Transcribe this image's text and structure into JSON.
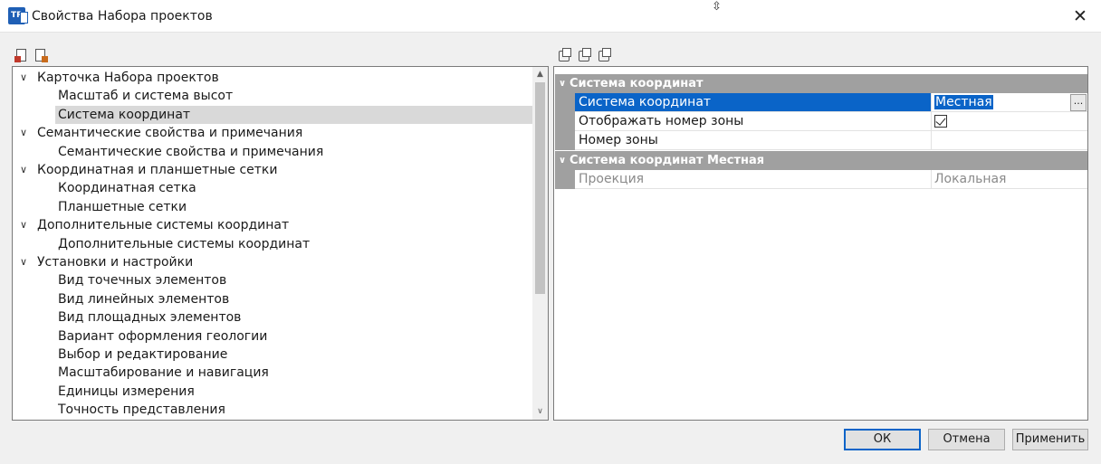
{
  "window": {
    "app_icon_text": "TR",
    "title": "Свойства Набора проектов",
    "close_glyph": "✕",
    "cursor_glyph": "⇳"
  },
  "tree": {
    "items": [
      {
        "label": "Карточка Набора проектов",
        "level": 0,
        "expanded": true
      },
      {
        "label": "Масштаб и система высот",
        "level": 1
      },
      {
        "label": "Система координат",
        "level": 1,
        "selected": true
      },
      {
        "label": "Семантические свойства и примечания",
        "level": 0,
        "expanded": true
      },
      {
        "label": "Семантические свойства и примечания",
        "level": 1
      },
      {
        "label": "Координатная и планшетные сетки",
        "level": 0,
        "expanded": true
      },
      {
        "label": "Координатная сетка",
        "level": 1
      },
      {
        "label": "Планшетные сетки",
        "level": 1
      },
      {
        "label": "Дополнительные системы координат",
        "level": 0,
        "expanded": true
      },
      {
        "label": "Дополнительные системы координат",
        "level": 1
      },
      {
        "label": "Установки и настройки",
        "level": 0,
        "expanded": true
      },
      {
        "label": "Вид точечных элементов",
        "level": 1
      },
      {
        "label": "Вид линейных элементов",
        "level": 1
      },
      {
        "label": "Вид площадных элементов",
        "level": 1
      },
      {
        "label": "Вариант оформления геологии",
        "level": 1
      },
      {
        "label": "Выбор и редактирование",
        "level": 1
      },
      {
        "label": "Масштабирование и навигация",
        "level": 1
      },
      {
        "label": "Единицы измерения",
        "level": 1
      },
      {
        "label": "Точность представления",
        "level": 1
      }
    ],
    "expand_glyph": "∨",
    "scroll_up_glyph": "▲",
    "scroll_down_glyph": "∨"
  },
  "properties": {
    "category1": "Система координат",
    "category2": "Система координат Местная",
    "category_chevron": "∨",
    "rows": {
      "coord_system": {
        "name": "Система координат",
        "value": "Местная",
        "button": "..."
      },
      "show_zone": {
        "name": "Отображать номер зоны",
        "checked": true
      },
      "zone_number": {
        "name": "Номер зоны",
        "value": ""
      },
      "projection": {
        "name": "Проекция",
        "value": "Локальная"
      }
    }
  },
  "buttons": {
    "ok": "ОК",
    "cancel": "Отмена",
    "apply": "Применить"
  },
  "colors": {
    "selection": "#0a64c8",
    "category_bg": "#a0a0a0",
    "tree_selected": "#d9d9d9"
  }
}
